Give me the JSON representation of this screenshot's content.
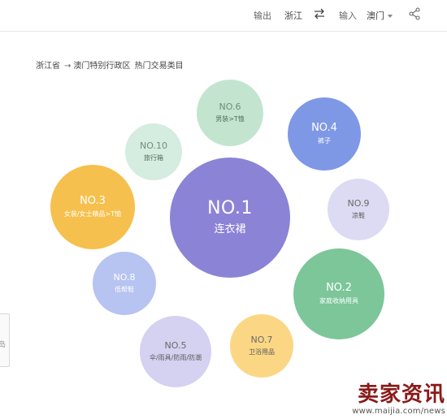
{
  "toolbar": {
    "export_label": "输出",
    "origin_value": "浙江",
    "swap_icon": "swap-arrows-icon",
    "input_label": "输入",
    "destination_value": "澳门",
    "share_icon": "share-icon"
  },
  "breadcrumb": {
    "origin": "浙江省",
    "arrow": "→",
    "destination": "澳门特别行政区",
    "title": "热门交易类目"
  },
  "bubbles": [
    {
      "rank": "NO.1",
      "category": "连衣裙",
      "color": "#8b83d6"
    },
    {
      "rank": "NO.2",
      "category": "家庭收纳用具",
      "color": "#7cc69a"
    },
    {
      "rank": "NO.3",
      "category": "女装/女士精品>T恤",
      "color": "#f6c04e"
    },
    {
      "rank": "NO.4",
      "category": "裤子",
      "color": "#7f98e6"
    },
    {
      "rank": "NO.5",
      "category": "伞/雨具/防雨/防潮",
      "color": "#d4d1f1"
    },
    {
      "rank": "NO.6",
      "category": "男装>T恤",
      "color": "#c3e5cf"
    },
    {
      "rank": "NO.7",
      "category": "卫浴用品",
      "color": "#fbd785"
    },
    {
      "rank": "NO.8",
      "category": "低帮鞋",
      "color": "#b7c3f0"
    },
    {
      "rank": "NO.9",
      "category": "凉鞋",
      "color": "#dcdbf3"
    },
    {
      "rank": "NO.10",
      "category": "旅行箱",
      "color": "#d5ece0"
    }
  ],
  "left_stub_text": "岛",
  "watermark": {
    "title": "卖家资讯",
    "url": "www.maijia.com/news"
  }
}
